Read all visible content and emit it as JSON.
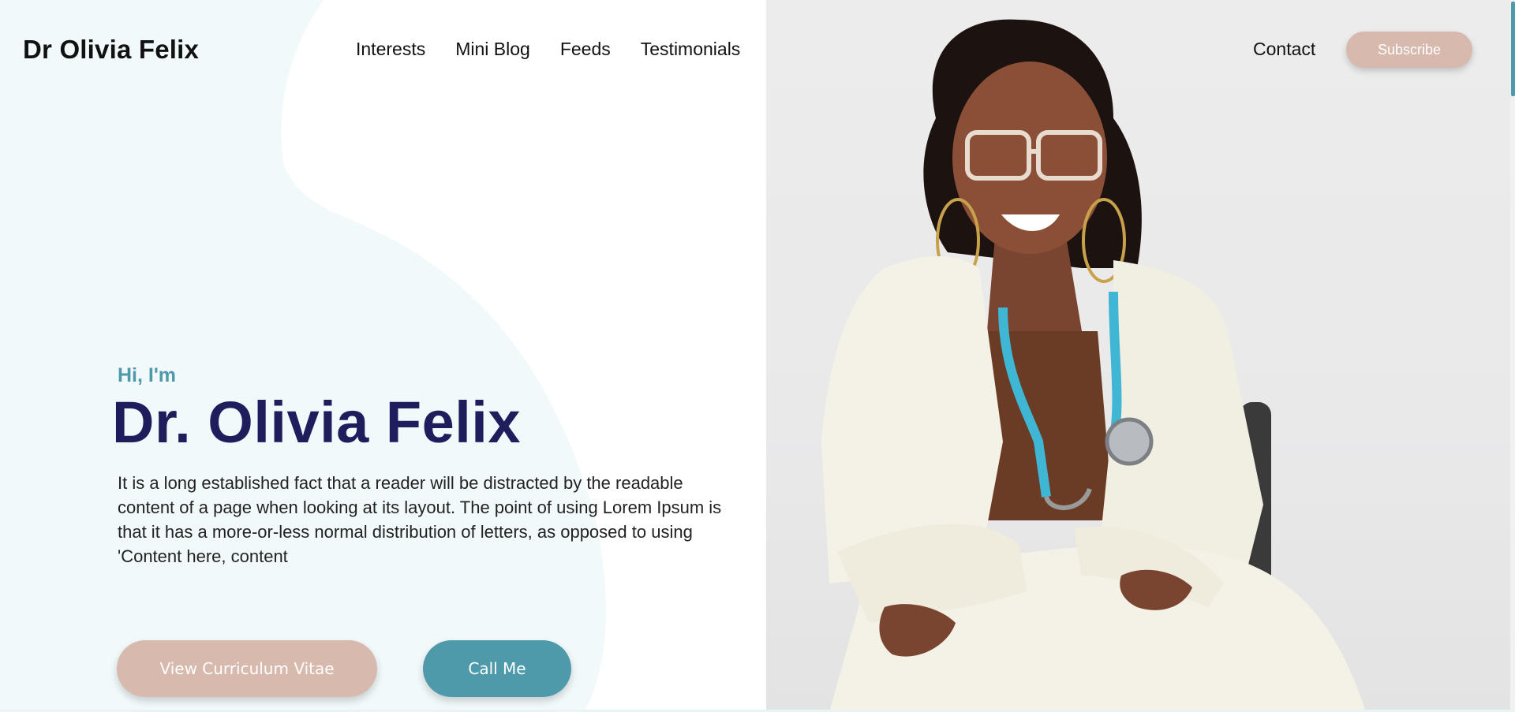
{
  "header": {
    "brand": "Dr Olivia Felix",
    "nav": [
      "Interests",
      "Mini Blog",
      "Feeds",
      "Testimonials"
    ],
    "contact": "Contact",
    "subscribe": "Subscribe"
  },
  "hero": {
    "greeting": "Hi, I'm",
    "title": "Dr. Olivia Felix",
    "description": "It is a long established fact that a reader will be distracted by the readable content of a page when looking at its layout. The point of using Lorem Ipsum is that it has a more-or-less normal distribution of letters, as opposed to using 'Content here, content",
    "cv_button": "View Curriculum Vitae",
    "call_button": "Call Me"
  },
  "colors": {
    "accent_teal": "#4f9aaa",
    "accent_rose": "#d8b9ae",
    "title_navy": "#1f1e5c",
    "wave_bg": "#f1f9fb"
  },
  "photo": {
    "alt": "Portrait photo of the doctor"
  }
}
